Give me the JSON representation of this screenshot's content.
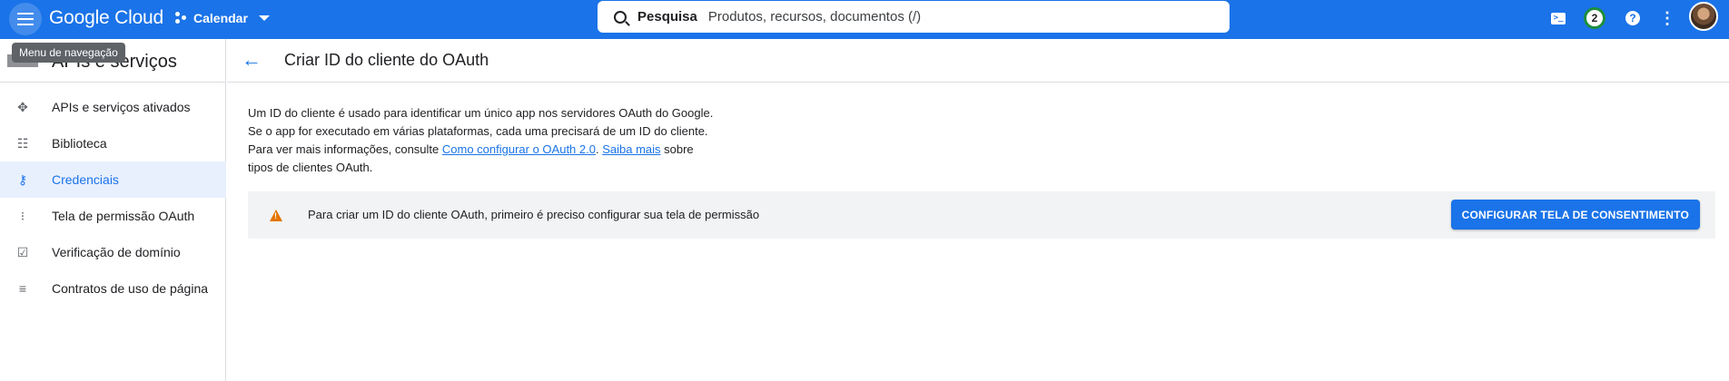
{
  "header": {
    "logo": "Google Cloud",
    "project": "Calendar",
    "search_label": "Pesquisa",
    "search_placeholder": "Produtos, recursos, documentos (/)",
    "notification_count": "2",
    "brand_color": "#1a73e8"
  },
  "tooltip": "Menu de navegação",
  "sidebar": {
    "title": "APIs e serviços",
    "items": [
      {
        "label": "APIs e serviços ativados",
        "icon": "apis-icon",
        "active": false
      },
      {
        "label": "Biblioteca",
        "icon": "library-icon",
        "active": false
      },
      {
        "label": "Credenciais",
        "icon": "key-icon",
        "active": true
      },
      {
        "label": "Tela de permissão OAuth",
        "icon": "consent-icon",
        "active": false
      },
      {
        "label": "Verificação de domínio",
        "icon": "domain-check-icon",
        "active": false
      },
      {
        "label": "Contratos de uso de página",
        "icon": "settings-list-icon",
        "active": false
      }
    ]
  },
  "page": {
    "title": "Criar ID do cliente do OAuth",
    "desc_line1": "Um ID do cliente é usado para identificar um único app nos servidores OAuth do Google.",
    "desc_line2": "Se o app for executado em várias plataformas, cada uma precisará de um ID do cliente.",
    "desc_line3_prefix": "Para ver mais informações, consulte ",
    "link1": "Como configurar o OAuth 2.0",
    "sep": ". ",
    "link2": "Saiba mais",
    "desc_line3_suffix": " sobre",
    "desc_line4": "tipos de clientes OAuth.",
    "banner_text": "Para criar um ID do cliente OAuth, primeiro é preciso configurar sua tela de permissão",
    "cta_label": "CONFIGURAR TELA DE CONSENTIMENTO",
    "warning_color": "#e37400"
  }
}
